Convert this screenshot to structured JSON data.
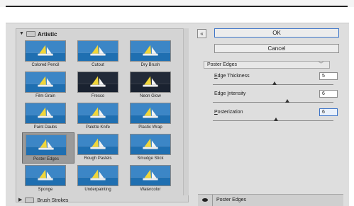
{
  "gallery": {
    "folder_open": "Artistic",
    "folder_closed": "Brush Strokes",
    "filters": [
      {
        "label": "Colored Pencil",
        "selected": false
      },
      {
        "label": "Cutout",
        "selected": false
      },
      {
        "label": "Dry Brush",
        "selected": false
      },
      {
        "label": "Film Grain",
        "selected": false
      },
      {
        "label": "Fresco",
        "selected": false
      },
      {
        "label": "Neon Glow",
        "selected": false
      },
      {
        "label": "Paint Daubs",
        "selected": false
      },
      {
        "label": "Palette Knife",
        "selected": false
      },
      {
        "label": "Plastic Wrap",
        "selected": false
      },
      {
        "label": "Poster Edges",
        "selected": true
      },
      {
        "label": "Rough Pastels",
        "selected": false
      },
      {
        "label": "Smudge Stick",
        "selected": false
      },
      {
        "label": "Sponge",
        "selected": false
      },
      {
        "label": "Underpainting",
        "selected": false
      },
      {
        "label": "Watercolor",
        "selected": false
      }
    ]
  },
  "panel": {
    "ok_label": "OK",
    "cancel_label": "Cancel",
    "filter_select": "Poster Edges",
    "params": [
      {
        "label_pre": "",
        "label_ul": "E",
        "label_post": "dge Thickness",
        "value": "5"
      },
      {
        "label_pre": "Edge ",
        "label_ul": "I",
        "label_post": "ntensity",
        "value": "6"
      },
      {
        "label_pre": "",
        "label_ul": "P",
        "label_post": "osterization",
        "value": "6"
      }
    ]
  },
  "layers": {
    "active_layer": "Poster Edges"
  },
  "colors": {
    "sky": "#3c86c6",
    "sea": "#1f6fb1",
    "sail": "#f1d63a",
    "focus": "#3c74c8"
  }
}
